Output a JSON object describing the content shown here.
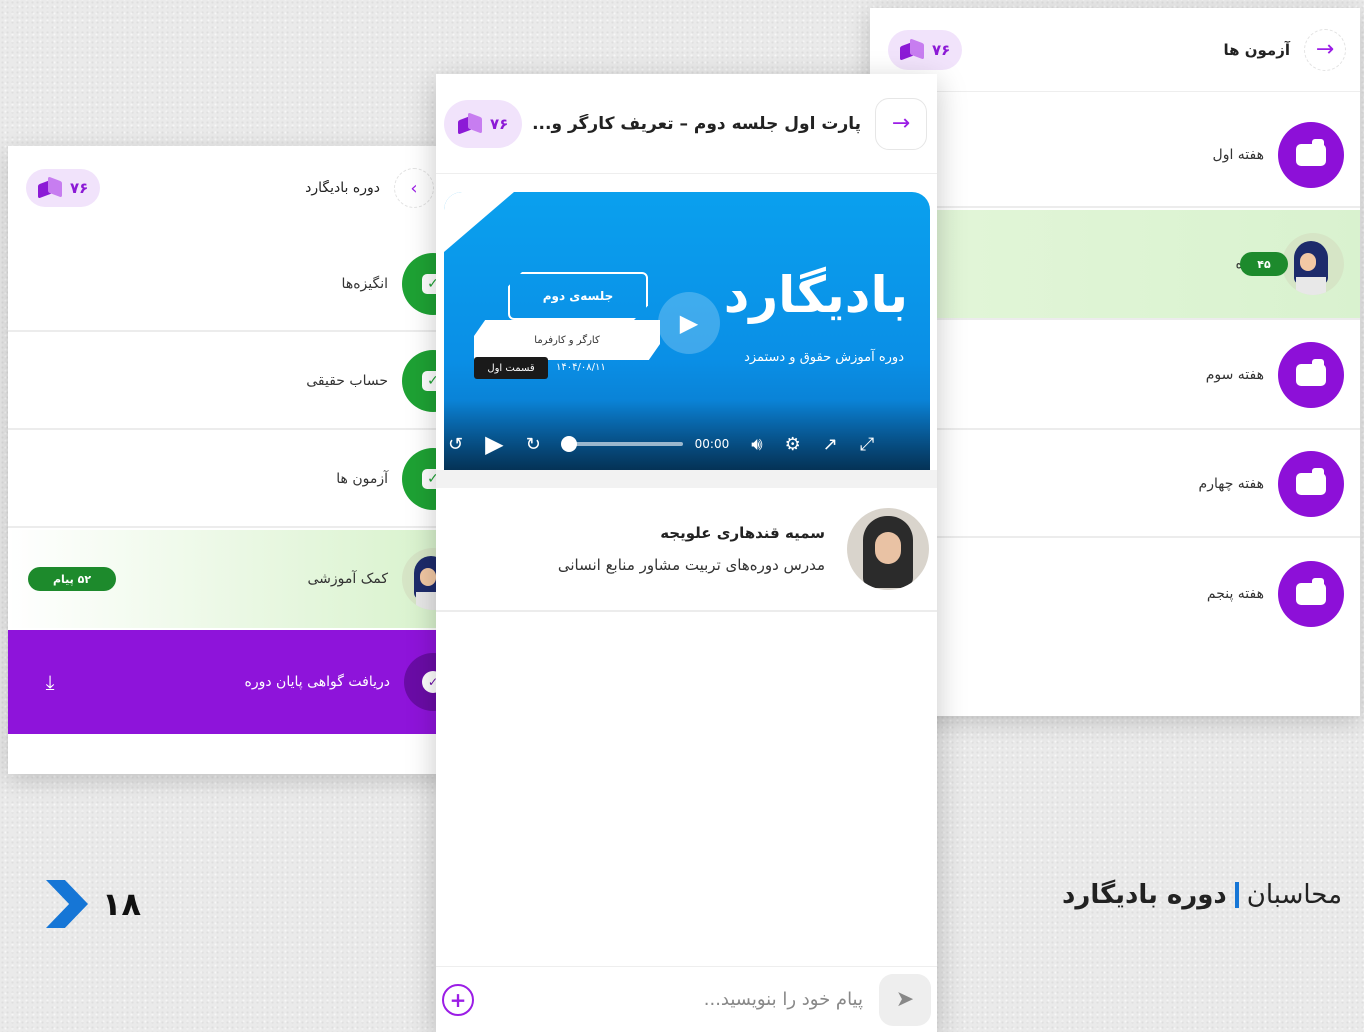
{
  "badge_value": "۷۶",
  "right_panel": {
    "title": "آزمون ها",
    "rows": [
      {
        "label": "هفته اول",
        "type": "folder"
      },
      {
        "label": "پروژه",
        "type": "avatar",
        "tag": "۴۵"
      },
      {
        "label": "هفته سوم",
        "type": "folder"
      },
      {
        "label": "هفته چهارم",
        "type": "folder"
      },
      {
        "label": "هفته پنجم",
        "type": "folder"
      }
    ]
  },
  "left_panel": {
    "title": "دوره بادیگارد",
    "rows": [
      {
        "label": "انگیزه‌ها",
        "type": "check"
      },
      {
        "label": "حساب حقیقی",
        "type": "check"
      },
      {
        "label": "آزمون ها",
        "type": "check"
      },
      {
        "label": "کمک آموزشی",
        "type": "avatar",
        "tag": "۵۲ پیام"
      }
    ],
    "certificate": "دریافت گواهی پایان دوره"
  },
  "center_panel": {
    "title": "پارت اول جلسه دوم – تعریف کارگر و...",
    "video": {
      "brand": "بادیگارد",
      "subtitle": "دوره آموزش حقوق و دستمزد",
      "session": "جلسه‌ی دوم",
      "topic": "کارگر و کارفرما",
      "part": "قسمت اول",
      "date": "۱۴۰۴/۰۸/۱۱",
      "time": "00:00",
      "progress": 0
    },
    "teacher": {
      "name": "سمیه قندهاری علویجه",
      "role": "مدرس دوره‌های تربیت مشاور منابع انسانی"
    },
    "composer_placeholder": "پیام خود را بنویسید..."
  },
  "footer": {
    "page_number": "۱۸",
    "section": "محاسبان",
    "course": "دوره بادیگارد"
  },
  "colors": {
    "purple": "#8d10d8",
    "green": "#1ea234",
    "blue": "#0a9aee",
    "accent_blue": "#1676d6"
  }
}
